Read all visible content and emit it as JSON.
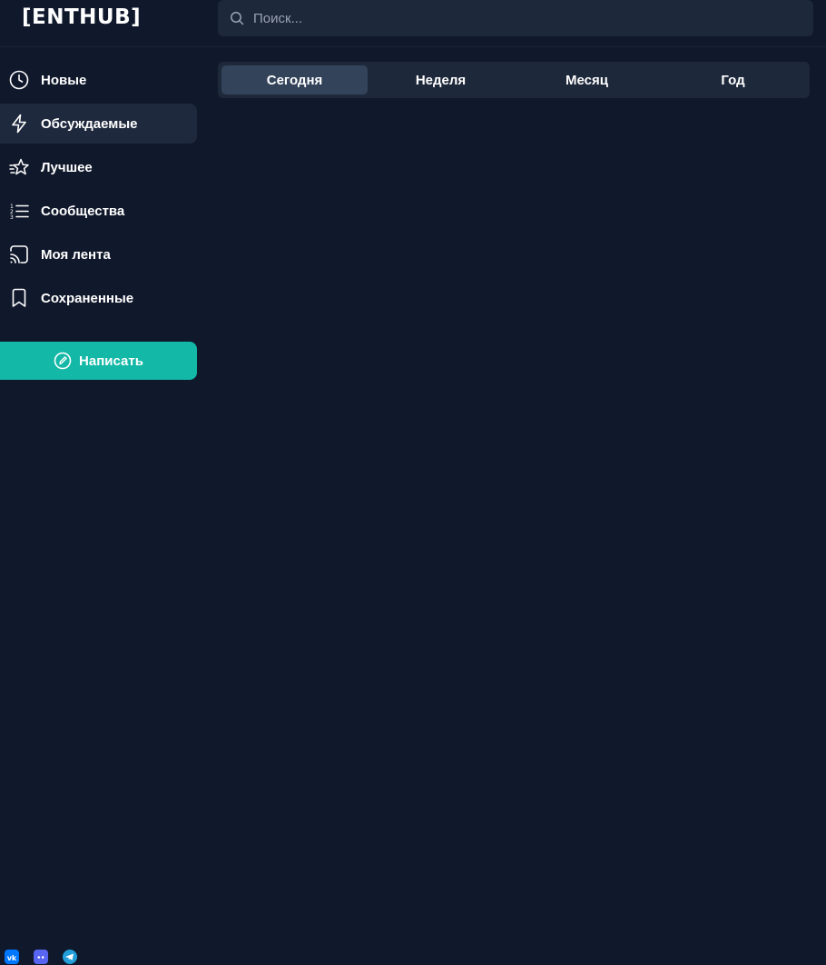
{
  "header": {
    "logo": "[ENTHUB]",
    "search": {
      "placeholder": "Поиск...",
      "value": ""
    }
  },
  "sidebar": {
    "items": [
      {
        "label": "Новые",
        "icon": "clock-icon",
        "active": false
      },
      {
        "label": "Обсуждаемые",
        "icon": "lightning-icon",
        "active": true
      },
      {
        "label": "Лучшее",
        "icon": "star-icon",
        "active": false
      },
      {
        "label": "Сообщества",
        "icon": "list-icon",
        "active": false
      },
      {
        "label": "Моя лента",
        "icon": "feed-icon",
        "active": false
      },
      {
        "label": "Сохраненные",
        "icon": "bookmark-icon",
        "active": false
      }
    ],
    "write_button": {
      "label": "Написать",
      "icon": "edit-icon"
    }
  },
  "period_tabs": [
    {
      "label": "Сегодня",
      "active": true
    },
    {
      "label": "Неделя",
      "active": false
    },
    {
      "label": "Месяц",
      "active": false
    },
    {
      "label": "Год",
      "active": false
    }
  ],
  "social": [
    "vk-icon",
    "discord-icon",
    "telegram-icon"
  ],
  "colors": {
    "background": "#10182b",
    "panel": "#1e283b",
    "active_tab": "#33435a",
    "accent": "#13b8a6"
  }
}
